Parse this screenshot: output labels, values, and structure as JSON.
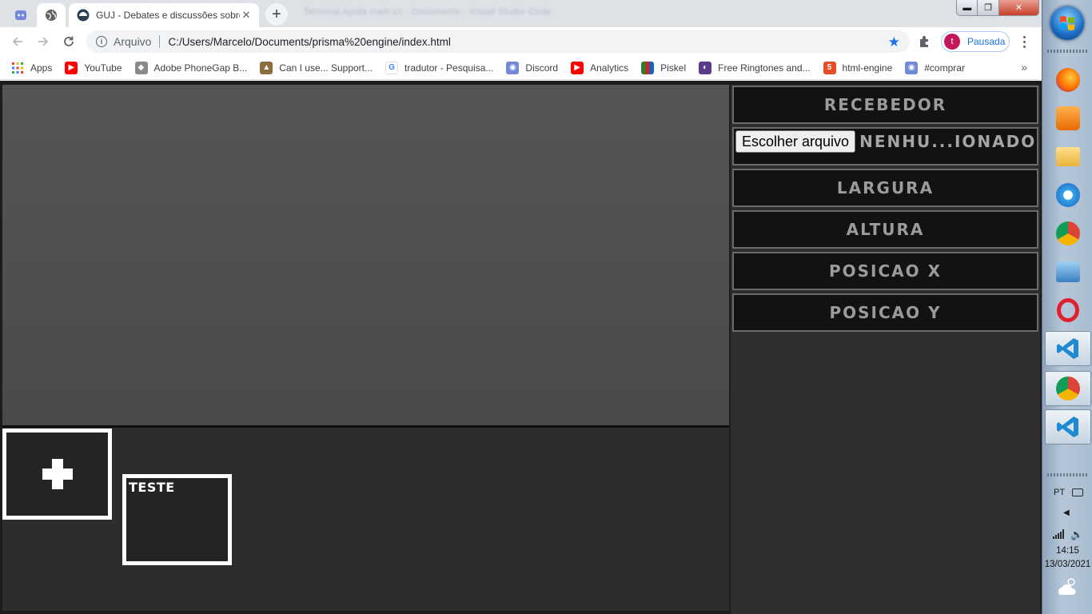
{
  "browser": {
    "tabs": [
      {
        "name": "discord",
        "title": ""
      },
      {
        "name": "globe",
        "title": ""
      },
      {
        "name": "guj",
        "title": "GUJ - Debates e discussões sobre"
      }
    ],
    "background_window_title": "Terminal   Ajuda        main.cc - Documents - Visual Studio Code",
    "address": {
      "scheme": "Arquivo",
      "url": "C:/Users/Marcelo/Documents/prisma%20engine/index.html"
    },
    "profile": {
      "initial": "t",
      "label": "Pausada"
    },
    "bookmarks": [
      {
        "label": "Apps",
        "icon": "apps-grid-icon",
        "color": "#4285f4"
      },
      {
        "label": "YouTube",
        "icon": "youtube-icon",
        "color": "#ff0000"
      },
      {
        "label": "Adobe PhoneGap B...",
        "icon": "phonegap-icon",
        "color": "#7a7a7a"
      },
      {
        "label": "Can I use... Support...",
        "icon": "caniuse-icon",
        "color": "#7a5c3a"
      },
      {
        "label": "tradutor - Pesquisa...",
        "icon": "google-icon",
        "color": "#4285f4"
      },
      {
        "label": "Discord",
        "icon": "discord-icon",
        "color": "#7289da"
      },
      {
        "label": "Analytics",
        "icon": "youtube-icon",
        "color": "#ff0000"
      },
      {
        "label": "Piskel",
        "icon": "piskel-icon",
        "color": "#3a8f3a"
      },
      {
        "label": "Free Ringtones and...",
        "icon": "ringtones-icon",
        "color": "#5b3b8c"
      },
      {
        "label": "html-engine",
        "icon": "html5-icon",
        "color": "#e44d26"
      },
      {
        "label": "#comprar",
        "icon": "discord-icon",
        "color": "#7289da"
      }
    ]
  },
  "app": {
    "sidebar": {
      "receiver_label": "RECEBEDOR",
      "file_button_label": "Escolher arquivo",
      "file_status": "NENHU...IONADO",
      "width_label": "LARGURA",
      "height_label": "ALTURA",
      "pos_x_label": "POSICAO X",
      "pos_y_label": "POSICAO Y"
    },
    "assets": [
      {
        "label": "TESTE"
      }
    ]
  },
  "taskbar": {
    "language": "PT",
    "time": "14:15",
    "date": "13/03/2021"
  },
  "colors": {
    "canvas": "#505050",
    "sidebar": "#2e2e2e",
    "prop_box": "#121212",
    "prop_text": "#9b9b9b",
    "accent": "#1a73e8"
  }
}
